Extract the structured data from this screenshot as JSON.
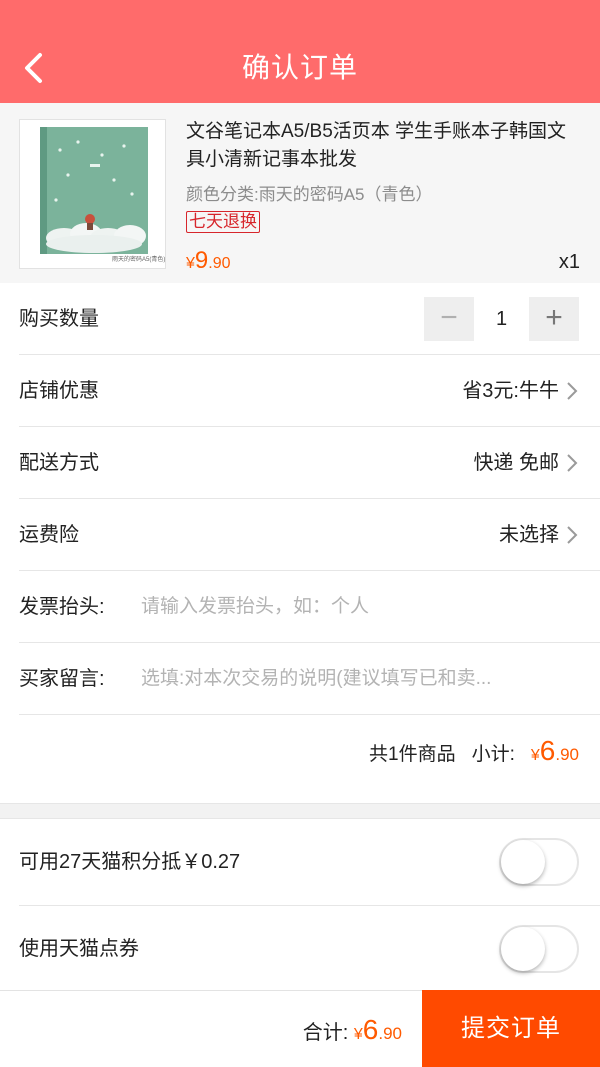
{
  "header": {
    "title": "确认订单",
    "back_icon": "chevron-left-icon"
  },
  "product": {
    "title": "文谷笔记本A5/B5活页本 学生手账本子韩国文具小清新记事本批发",
    "spec": "颜色分类:雨天的密码A5（青色）",
    "badge": "七天退换",
    "price_symbol": "¥",
    "price_int": "9",
    "price_dec": ".90",
    "quantity": "x1",
    "image_caption": "雨天的密码A5(青色)"
  },
  "order": {
    "quantity_label": "购买数量",
    "quantity_value": "1",
    "minus_symbol": "−",
    "plus_symbol": "+",
    "shop_discount_label": "店铺优惠",
    "shop_discount_value": "省3元:牛牛",
    "delivery_label": "配送方式",
    "delivery_value": "快递 免邮",
    "insurance_label": "运费险",
    "insurance_value": "未选择",
    "invoice_label": "发票抬头:",
    "invoice_placeholder": "请输入发票抬头，如：个人",
    "message_label": "买家留言:",
    "message_placeholder": "选填:对本次交易的说明(建议填写已和卖...",
    "count_text": "共1件商品",
    "subtotal_label": "小计:",
    "subtotal_symbol": "¥",
    "subtotal_int": "6",
    "subtotal_dec": ".90"
  },
  "options": {
    "points_label": "可用27天猫积分抵￥0.27",
    "points_enabled": false,
    "coupon_label": "使用天猫点券",
    "coupon_enabled": false
  },
  "footer": {
    "total_label": "合计:",
    "total_symbol": "¥",
    "total_int": "6",
    "total_dec": ".90",
    "submit_label": "提交订单"
  },
  "colors": {
    "header_bg": "#ff6b6b",
    "accent_orange": "#ff5a00",
    "submit_bg": "#ff4a00",
    "badge_red": "#d7262c"
  }
}
